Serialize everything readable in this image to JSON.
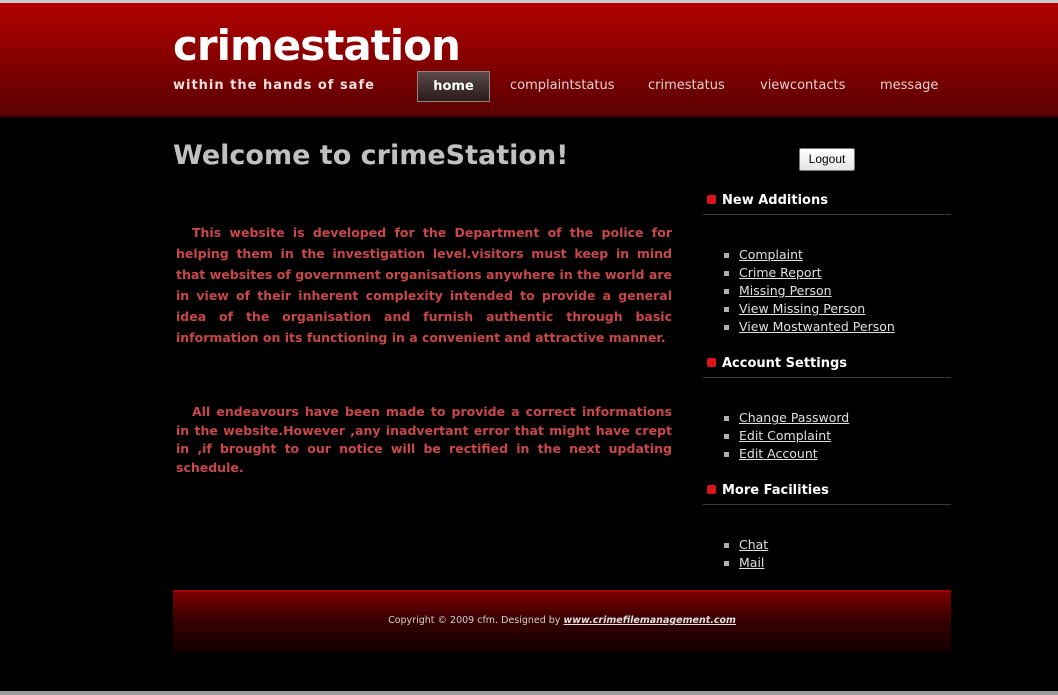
{
  "site": {
    "logo": "crimestation",
    "tagline": "within the hands of safe"
  },
  "nav": {
    "items": [
      {
        "label": "home",
        "active": true
      },
      {
        "label": "complaintstatus"
      },
      {
        "label": "crimestatus"
      },
      {
        "label": "viewcontacts"
      },
      {
        "label": "message"
      }
    ]
  },
  "main": {
    "title": "Welcome to crimeStation!",
    "paragraph1": "This website is developed for the Department of the police for helping them in the investigation level.visitors must keep in mind that websites of government organisations anywhere in the world are in view of their inherent complexity intended to provide a general idea of the organisation and furnish authentic through basic information on its functioning in a convenient and attractive manner.",
    "paragraph2": "All endeavours have been made to provide a correct informations in the website.However ,any inadvertant error that might have crept in ,if brought to our notice will be rectified in the next updating schedule."
  },
  "sidebar": {
    "logout_label": "Logout",
    "sections": [
      {
        "heading": "New Additions",
        "links": [
          "Complaint",
          "Crime Report",
          "Missing Person",
          "View Missing Person",
          "View Mostwanted Person"
        ]
      },
      {
        "heading": "Account Settings",
        "links": [
          "Change Password",
          "Edit Complaint",
          "Edit Account"
        ]
      },
      {
        "heading": "More Facilities",
        "links": [
          "Chat",
          "Mail"
        ]
      }
    ]
  },
  "footer": {
    "copyright": "Copyright © 2009 cfm. Designed by ",
    "designer_link": "www.crimefilemanagement.com"
  },
  "colors": {
    "header_red": "#a00000",
    "body_text_red": "#c84848",
    "bullet_red": "#d9141a",
    "background": "#000000"
  }
}
